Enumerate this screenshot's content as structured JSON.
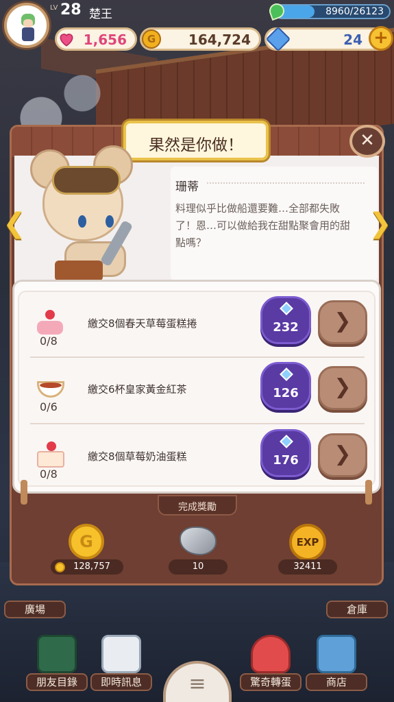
{
  "hud": {
    "level_label": "LV",
    "level": "28",
    "player_name": "楚王",
    "xp_text": "8960/26123",
    "xp_progress": 0.343,
    "hearts": "1,656",
    "gold": "164,724",
    "gems": "24",
    "add_label": "+"
  },
  "dialog": {
    "title": "果然是你做！",
    "close_label": "✕",
    "npc_name": "珊蒂",
    "npc_message": "料理似乎比做船還要難…全部都失敗了！恩…可以做給我在甜點聚會用的甜點嗎？",
    "prev_label": "❮",
    "next_label": "❯"
  },
  "tasks": [
    {
      "label": "繳交8個春天草莓蛋糕捲",
      "progress": "0/8",
      "reward": "232",
      "icon": "strawberry-roll-icon",
      "go_label": "❯"
    },
    {
      "label": "繳交6杯皇家黃金紅茶",
      "progress": "0/6",
      "reward": "126",
      "icon": "tea-cup-icon",
      "go_label": "❯"
    },
    {
      "label": "繳交8個草莓奶油蛋糕",
      "progress": "0/8",
      "reward": "176",
      "icon": "strawberry-cake-icon",
      "go_label": "❯"
    }
  ],
  "completion": {
    "label": "完成獎勵",
    "gold": "128,757",
    "gold_icon_letter": "G",
    "ore": "10",
    "exp": "32411",
    "exp_icon_text": "EXP"
  },
  "nav": {
    "plaza": "廣場",
    "warehouse": "倉庫",
    "friends": "朋友目錄",
    "chat": "即時訊息",
    "gacha": "驚奇轉蛋",
    "shop": "商店",
    "menu_icon": "≡"
  },
  "colors": {
    "gem_button": "#5a3aa3",
    "title_border": "#e9c24a",
    "dialog_frame": "#6e3f32"
  }
}
